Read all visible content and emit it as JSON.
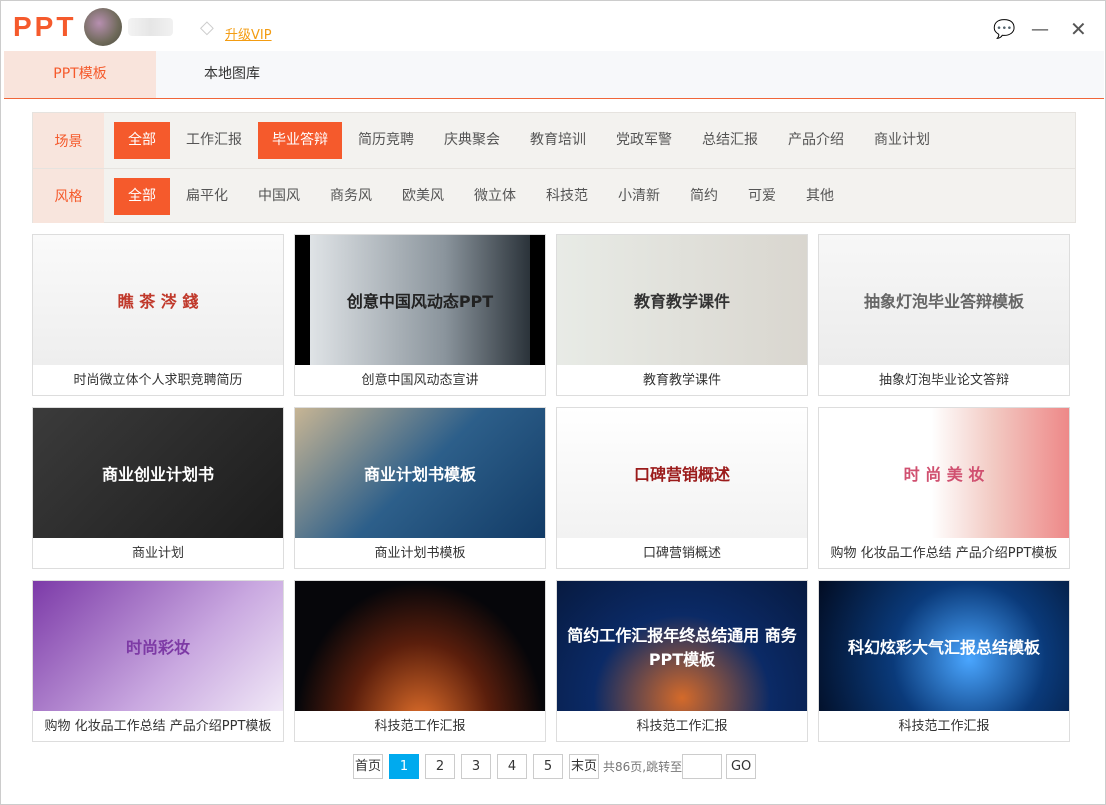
{
  "app": {
    "logo": "PPT",
    "vip_label": "升级VIP"
  },
  "tabs": [
    {
      "label": "PPT模板"
    },
    {
      "label": "本地图库"
    }
  ],
  "filters": {
    "scene": {
      "label": "场景",
      "items": [
        "全部",
        "工作汇报",
        "毕业答辩",
        "简历竞聘",
        "庆典聚会",
        "教育培训",
        "党政军警",
        "总结汇报",
        "产品介绍",
        "商业计划"
      ],
      "selected": [
        "全部",
        "毕业答辩"
      ]
    },
    "style": {
      "label": "风格",
      "items": [
        "全部",
        "扁平化",
        "中国风",
        "商务风",
        "欧美风",
        "微立体",
        "科技范",
        "小清新",
        "简约",
        "可爱",
        "其他"
      ],
      "selected": [
        "全部"
      ]
    }
  },
  "templates": [
    {
      "title": "时尚微立体个人求职竞聘简历",
      "thumb_text": "瞧 茶 涔 錢",
      "bg": "linear-gradient(#fafafa,#eee)",
      "fg": "#c0392b"
    },
    {
      "title": "创意中国风动态宣讲",
      "thumb_text": "创意中国风动态PPT",
      "bg": "linear-gradient(90deg,#000 6%,#dfe3e6 6%,#8a949c 60%,#2b333a 94%,#000 94%)",
      "fg": "#222"
    },
    {
      "title": "教育教学课件",
      "thumb_text": "教育教学课件",
      "bg": "linear-gradient(90deg,#e8ebe6,#d9d6cf)",
      "fg": "#333"
    },
    {
      "title": "抽象灯泡毕业论文答辩",
      "thumb_text": "抽象灯泡毕业答辩模板",
      "bg": "linear-gradient(#f7f7f7,#ececec)",
      "fg": "#666"
    },
    {
      "title": "商业计划",
      "thumb_text": "商业创业计划书",
      "bg": "linear-gradient(135deg,#3b3b3b,#1c1c1c)",
      "fg": "#fff"
    },
    {
      "title": "商业计划书模板",
      "thumb_text": "商业计划书模板",
      "bg": "linear-gradient(135deg,#c7b594,#2d5f8a 50%,#123b66)",
      "fg": "#fff"
    },
    {
      "title": "口碑营销概述",
      "thumb_text": "口碑营销概述",
      "bg": "linear-gradient(#fff,#f2f2f2)",
      "fg": "#9b1b1b"
    },
    {
      "title": "购物 化妆品工作总结 产品介绍PPT模板",
      "thumb_text": "时 尚 美 妆",
      "bg": "linear-gradient(90deg,#fff 45%,#f2c9c2 70%,#e88)",
      "fg": "#d05070"
    },
    {
      "title": "购物 化妆品工作总结 产品介绍PPT模板",
      "thumb_text": "时尚彩妆",
      "bg": "linear-gradient(135deg,#7c3aa8,#c9a8e0 60%,#f1e9f7)",
      "fg": "#7d3aa5"
    },
    {
      "title": "科技范工作汇报",
      "thumb_text": "",
      "bg": "radial-gradient(ellipse at 50% 110%,#e2702b,#5a1e0c 40%,#06060a 70%)",
      "fg": "#fff"
    },
    {
      "title": "科技范工作汇报",
      "thumb_text": "简约工作汇报年终总结通用 商务PPT模板",
      "bg": "radial-gradient(ellipse at 50% 90%,#d46a2a,#0b2a66 50%,#071a40)",
      "fg": "#fff"
    },
    {
      "title": "科技范工作汇报",
      "thumb_text": "科幻炫彩大气汇报总结模板",
      "bg": "radial-gradient(circle at 60% 60%,#4aa6ff,#0a3a7a 45%,#020c22)",
      "fg": "#fff"
    }
  ],
  "pager": {
    "first": "首页",
    "pages": [
      "1",
      "2",
      "3",
      "4",
      "5"
    ],
    "current": "1",
    "last": "末页",
    "info": "共86页,跳转至",
    "go": "GO",
    "jump_value": ""
  }
}
